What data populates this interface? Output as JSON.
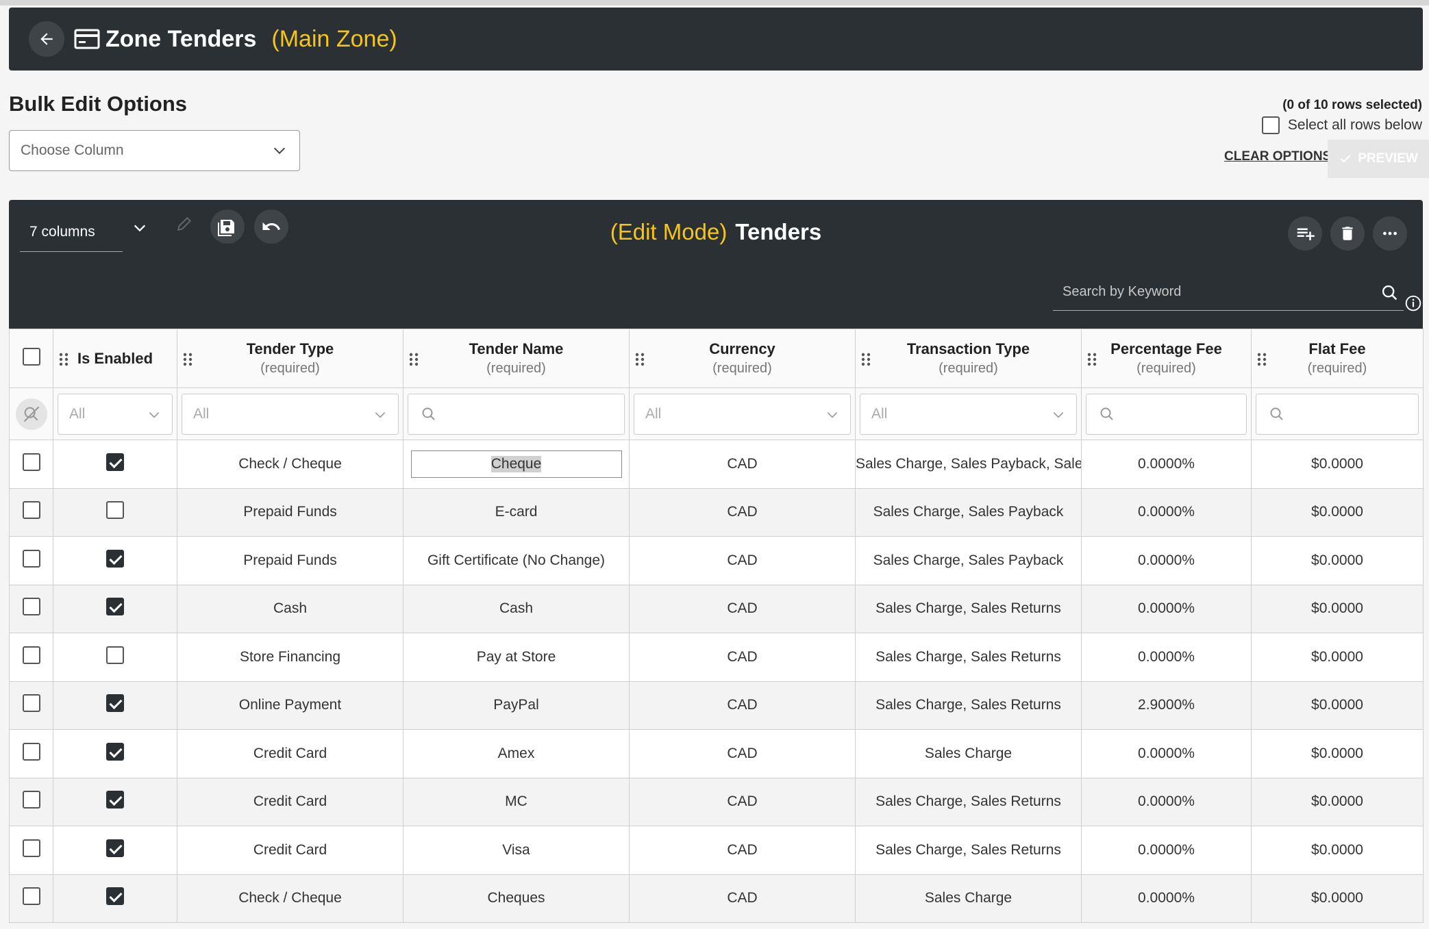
{
  "header": {
    "title": "Zone Tenders",
    "zone": "(Main Zone)"
  },
  "bulk": {
    "title": "Bulk Edit Options",
    "choose_column_placeholder": "Choose Column",
    "rows_selected": "(0 of 10 rows selected)",
    "select_all_label": "Select all rows below",
    "clear_options": "CLEAR OPTIONS",
    "preview": "PREVIEW"
  },
  "grid": {
    "columns_selector": "7 columns",
    "mode": "(Edit Mode)",
    "title": "Tenders",
    "search_placeholder": "Search by Keyword",
    "required_label": "(required)",
    "columns": {
      "is_enabled": "Is Enabled",
      "tender_type": "Tender Type",
      "tender_name": "Tender Name",
      "currency": "Currency",
      "transaction_type": "Transaction Type",
      "percentage_fee": "Percentage Fee",
      "flat_fee": "Flat Fee"
    },
    "filters": {
      "all": "All"
    },
    "rows": [
      {
        "enabled": true,
        "tender_type": "Check / Cheque",
        "tender_name": "Cheque",
        "currency": "CAD",
        "transaction_type": "Sales Charge, Sales Payback, Sales Returns",
        "percentage_fee": "0.0000%",
        "flat_fee": "$0.0000"
      },
      {
        "enabled": false,
        "tender_type": "Prepaid Funds",
        "tender_name": "E-card",
        "currency": "CAD",
        "transaction_type": "Sales Charge, Sales Payback",
        "percentage_fee": "0.0000%",
        "flat_fee": "$0.0000"
      },
      {
        "enabled": true,
        "tender_type": "Prepaid Funds",
        "tender_name": "Gift Certificate (No Change)",
        "currency": "CAD",
        "transaction_type": "Sales Charge, Sales Payback",
        "percentage_fee": "0.0000%",
        "flat_fee": "$0.0000"
      },
      {
        "enabled": true,
        "tender_type": "Cash",
        "tender_name": "Cash",
        "currency": "CAD",
        "transaction_type": "Sales Charge, Sales Returns",
        "percentage_fee": "0.0000%",
        "flat_fee": "$0.0000"
      },
      {
        "enabled": false,
        "tender_type": "Store Financing",
        "tender_name": "Pay at Store",
        "currency": "CAD",
        "transaction_type": "Sales Charge, Sales Returns",
        "percentage_fee": "0.0000%",
        "flat_fee": "$0.0000"
      },
      {
        "enabled": true,
        "tender_type": "Online Payment",
        "tender_name": "PayPal",
        "currency": "CAD",
        "transaction_type": "Sales Charge, Sales Returns",
        "percentage_fee": "2.9000%",
        "flat_fee": "$0.0000"
      },
      {
        "enabled": true,
        "tender_type": "Credit Card",
        "tender_name": "Amex",
        "currency": "CAD",
        "transaction_type": "Sales Charge",
        "percentage_fee": "0.0000%",
        "flat_fee": "$0.0000"
      },
      {
        "enabled": true,
        "tender_type": "Credit Card",
        "tender_name": "MC",
        "currency": "CAD",
        "transaction_type": "Sales Charge, Sales Returns",
        "percentage_fee": "0.0000%",
        "flat_fee": "$0.0000"
      },
      {
        "enabled": true,
        "tender_type": "Credit Card",
        "tender_name": "Visa",
        "currency": "CAD",
        "transaction_type": "Sales Charge, Sales Returns",
        "percentage_fee": "0.0000%",
        "flat_fee": "$0.0000"
      },
      {
        "enabled": true,
        "tender_type": "Check / Cheque",
        "tender_name": "Cheques",
        "currency": "CAD",
        "transaction_type": "Sales Charge",
        "percentage_fee": "0.0000%",
        "flat_fee": "$0.0000"
      }
    ]
  },
  "colors": {
    "header_bg": "#2b3034",
    "accent": "#f5c518"
  },
  "icons": [
    "back-arrow-icon",
    "card-icon",
    "chevron-down-icon",
    "pencil-icon",
    "save-icon",
    "undo-icon",
    "add-row-icon",
    "trash-icon",
    "more-icon",
    "search-icon",
    "info-icon",
    "drag-grip-icon",
    "filter-clear-icon",
    "check-icon"
  ]
}
